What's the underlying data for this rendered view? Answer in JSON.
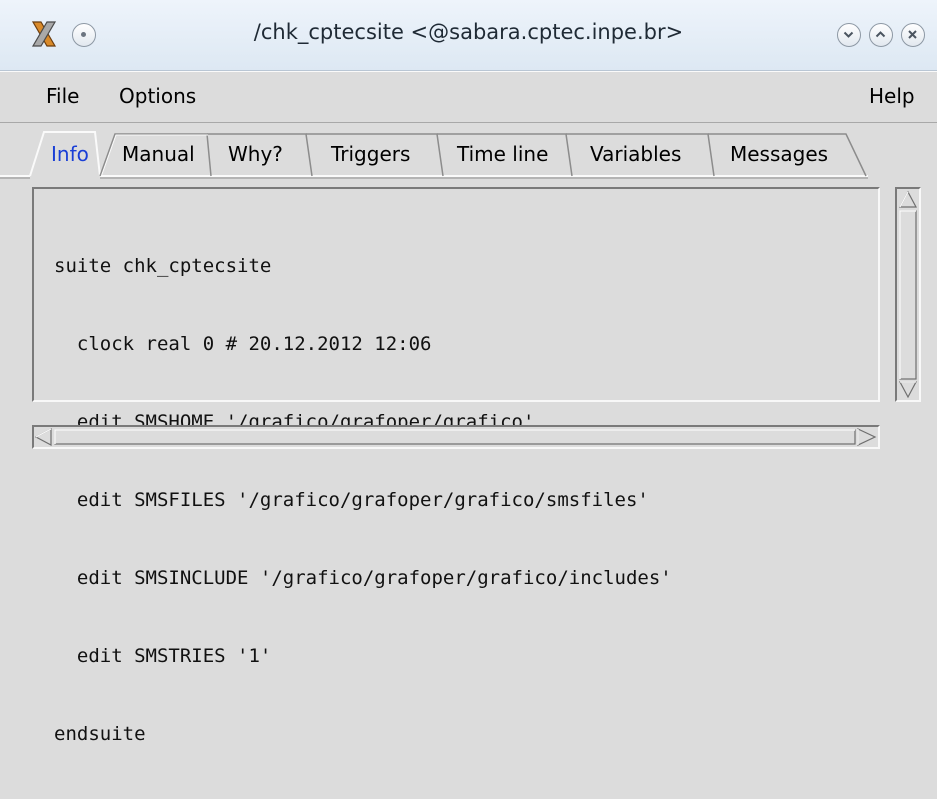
{
  "window": {
    "title": "/chk_cptecsite <@sabara.cptec.inpe.br>"
  },
  "titlebar_icons": [
    "app-icon",
    "menu-circle-icon",
    "minimize-icon",
    "maximize-icon",
    "close-icon"
  ],
  "menubar": {
    "file_label": "File",
    "options_label": "Options",
    "help_label": "Help"
  },
  "tabs": [
    {
      "label": "Info",
      "active": true
    },
    {
      "label": "Manual",
      "active": false
    },
    {
      "label": "Why?",
      "active": false
    },
    {
      "label": "Triggers",
      "active": false
    },
    {
      "label": "Time line",
      "active": false
    },
    {
      "label": "Variables",
      "active": false
    },
    {
      "label": "Messages",
      "active": false
    }
  ],
  "content": {
    "lines": [
      "suite chk_cptecsite",
      "  clock real 0 # 20.12.2012 12:06",
      "  edit SMSHOME '/grafico/grafoper/grafico'",
      "  edit SMSFILES '/grafico/grafoper/grafico/smsfiles'",
      "  edit SMSINCLUDE '/grafico/grafoper/grafico/includes'",
      "  edit SMSTRIES '1'",
      "endsuite"
    ]
  },
  "colors": {
    "active_tab_text": "#1a3fd6",
    "background": "#dcdcdc",
    "titlebar": "#e6eef7"
  }
}
